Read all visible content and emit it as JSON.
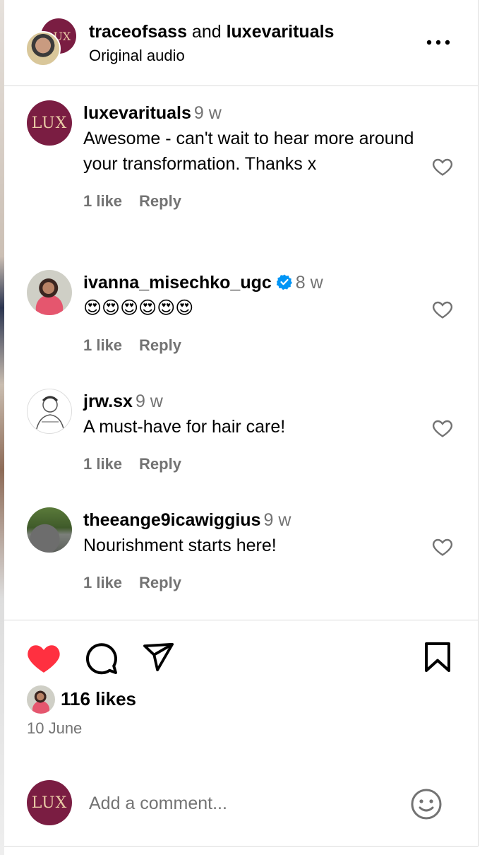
{
  "header": {
    "user1": "traceofsass",
    "conj": " and ",
    "user2": "luxevarituals",
    "subtitle": "Original audio",
    "lux_mark": "LUX",
    "more_icon": "more-horizontal-icon"
  },
  "comments": [
    {
      "user": "luxevarituals",
      "time": "9 w",
      "text": "Awesome - can't wait to hear more around your transformation. Thanks x",
      "likes": "1 like",
      "reply": "Reply",
      "avatar_text": "LUX",
      "verified": false
    },
    {
      "user": "ivanna_misechko_ugc",
      "time": "8 w",
      "text": "😍😍😍😍😍😍",
      "likes": "1 like",
      "reply": "Reply",
      "verified": true
    },
    {
      "user": "jrw.sx",
      "time": "9 w",
      "text": "A must-have for hair care!",
      "likes": "1 like",
      "reply": "Reply",
      "verified": false
    },
    {
      "user": "theeange9icawiggius",
      "time": "9 w",
      "text": "Nourishment starts here!",
      "likes": "1 like",
      "reply": "Reply",
      "verified": false
    }
  ],
  "actions": {
    "like_icon": "heart-filled-icon",
    "comment_icon": "comment-icon",
    "share_icon": "send-icon",
    "save_icon": "bookmark-icon",
    "liked": true
  },
  "likes_text": "116 likes",
  "date": "10 June",
  "comment_box": {
    "avatar_text": "LUX",
    "placeholder": "Add a comment...",
    "emoji_icon": "smiley-icon"
  },
  "colors": {
    "like_red": "#ff3040",
    "lux_maroon": "#7a1d42",
    "verified_blue": "#0095f6",
    "secondary_text": "#737373"
  }
}
